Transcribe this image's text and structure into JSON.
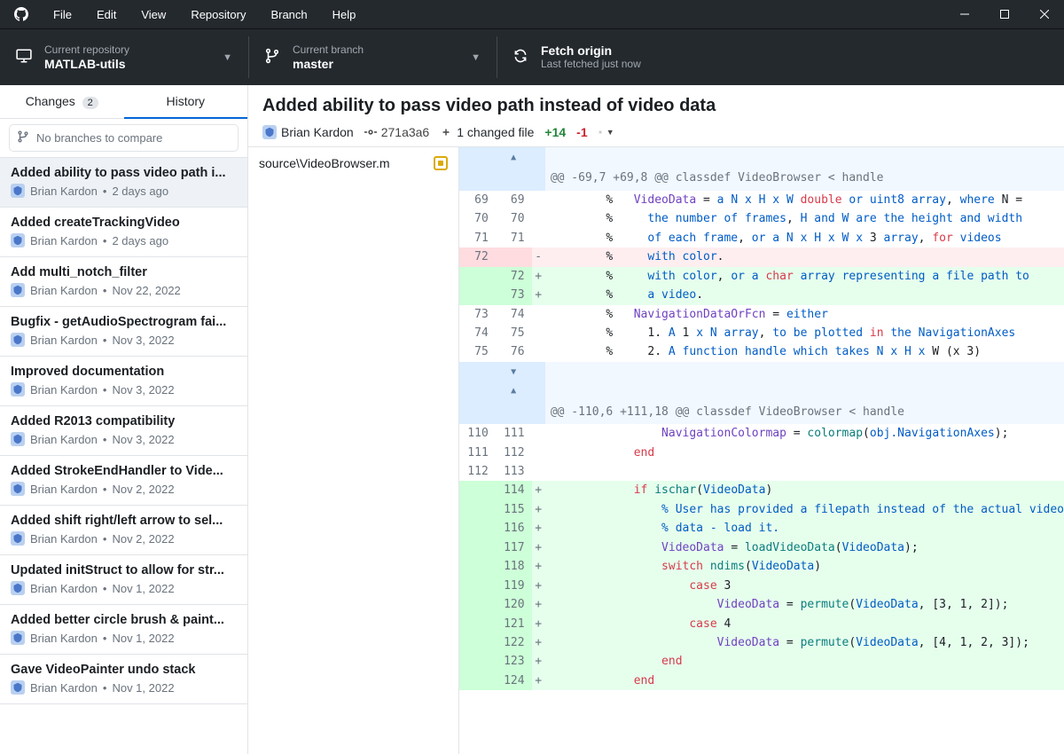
{
  "menu": {
    "file": "File",
    "edit": "Edit",
    "view": "View",
    "repository": "Repository",
    "branch": "Branch",
    "help": "Help"
  },
  "toolbar": {
    "repo": {
      "label": "Current repository",
      "value": "MATLAB-utils"
    },
    "branch": {
      "label": "Current branch",
      "value": "master"
    },
    "fetch": {
      "label": "Fetch origin",
      "value": "Last fetched just now"
    }
  },
  "sidebar": {
    "tabs": {
      "changes": "Changes",
      "changes_count": "2",
      "history": "History"
    },
    "compare_placeholder": "No branches to compare",
    "commits": [
      {
        "title": "Added ability to pass video path i...",
        "author": "Brian Kardon",
        "time": "2 days ago",
        "selected": true
      },
      {
        "title": "Added createTrackingVideo",
        "author": "Brian Kardon",
        "time": "2 days ago"
      },
      {
        "title": "Add multi_notch_filter",
        "author": "Brian Kardon",
        "time": "Nov 22, 2022"
      },
      {
        "title": "Bugfix - getAudioSpectrogram fai...",
        "author": "Brian Kardon",
        "time": "Nov 3, 2022"
      },
      {
        "title": "Improved documentation",
        "author": "Brian Kardon",
        "time": "Nov 3, 2022"
      },
      {
        "title": "Added R2013 compatibility",
        "author": "Brian Kardon",
        "time": "Nov 3, 2022"
      },
      {
        "title": "Added StrokeEndHandler to Vide...",
        "author": "Brian Kardon",
        "time": "Nov 2, 2022"
      },
      {
        "title": "Added shift right/left arrow to sel...",
        "author": "Brian Kardon",
        "time": "Nov 2, 2022"
      },
      {
        "title": "Updated initStruct to allow for str...",
        "author": "Brian Kardon",
        "time": "Nov 1, 2022"
      },
      {
        "title": "Added better circle brush & paint...",
        "author": "Brian Kardon",
        "time": "Nov 1, 2022"
      },
      {
        "title": "Gave VideoPainter undo stack",
        "author": "Brian Kardon",
        "time": "Nov 1, 2022"
      }
    ]
  },
  "commit_detail": {
    "title": "Added ability to pass video path instead of video data",
    "author": "Brian Kardon",
    "sha": "271a3a6",
    "changed_files": "1 changed file",
    "additions": "+14",
    "deletions": "-1"
  },
  "files": {
    "path": "source\\VideoBrowser.m"
  },
  "hunks": [
    {
      "header": "@@ -69,7 +69,8 @@ classdef VideoBrowser < handle"
    },
    {
      "header": "@@ -110,6 +111,18 @@ classdef VideoBrowser < handle"
    }
  ],
  "lines": {
    "l69": "69",
    "l70": "70",
    "l71": "71",
    "l72": "72",
    "l73": "73",
    "l74": "74",
    "l75": "75",
    "l76": "76",
    "l110": "110",
    "l111": "111",
    "l112": "112",
    "l113": "113",
    "l114": "114",
    "l115": "115",
    "l116": "116",
    "l117": "117",
    "l118": "118",
    "l119": "119",
    "l120": "120",
    "l121": "121",
    "l122": "122",
    "l123": "123",
    "l124": "124"
  }
}
